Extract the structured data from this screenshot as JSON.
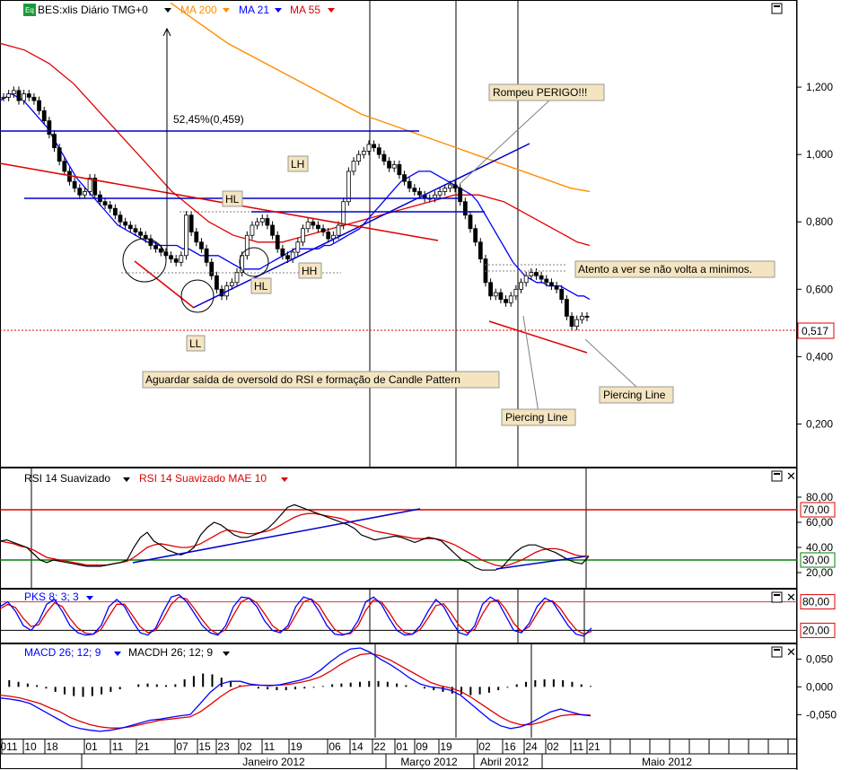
{
  "chart_data": [
    {
      "type": "line",
      "panel": "price",
      "title": "BES:xlis Diário TMG+0",
      "legend": [
        "BES:xlis Diário TMG+0",
        "MA 200",
        "MA 21",
        "MA 55"
      ],
      "legend_colors": {
        "MA 200": "#ff8c00",
        "MA 21": "#0000ff",
        "MA 55": "#e00000"
      },
      "y_ticks": [
        "1,200",
        "1,000",
        "0,800",
        "0,600",
        "0,400",
        "0,200"
      ],
      "ylim": [
        0.1,
        1.4
      ],
      "last_value": "0,517",
      "annotations": [
        "52,45%(0,459)",
        "LH",
        "HL",
        "HL",
        "HH",
        "LL",
        "Rompeu  PERIGO!!!",
        "Atento a ver se não volta a minimos.",
        "Aguardar saída de oversold do RSI e formação de Candle Pattern",
        "Piercing Line",
        "Piercing Line"
      ],
      "close": [
        1.17,
        1.18,
        1.19,
        1.16,
        1.18,
        1.17,
        1.16,
        1.13,
        1.1,
        1.06,
        1.02,
        0.98,
        0.95,
        0.92,
        0.9,
        0.88,
        0.89,
        0.93,
        0.88,
        0.86,
        0.85,
        0.84,
        0.82,
        0.8,
        0.79,
        0.78,
        0.77,
        0.76,
        0.75,
        0.73,
        0.72,
        0.71,
        0.7,
        0.69,
        0.68,
        0.7,
        0.82,
        0.77,
        0.74,
        0.72,
        0.68,
        0.64,
        0.6,
        0.58,
        0.61,
        0.62,
        0.65,
        0.7,
        0.76,
        0.79,
        0.8,
        0.81,
        0.79,
        0.76,
        0.72,
        0.7,
        0.69,
        0.71,
        0.74,
        0.78,
        0.8,
        0.79,
        0.78,
        0.77,
        0.75,
        0.76,
        0.79,
        0.86,
        0.95,
        0.98,
        1.0,
        1.01,
        1.03,
        1.02,
        1.0,
        0.98,
        0.96,
        0.97,
        0.94,
        0.92,
        0.9,
        0.89,
        0.88,
        0.87,
        0.87,
        0.88,
        0.89,
        0.9,
        0.91,
        0.9,
        0.86,
        0.82,
        0.78,
        0.74,
        0.69,
        0.62,
        0.58,
        0.59,
        0.57,
        0.56,
        0.58,
        0.6,
        0.62,
        0.64,
        0.65,
        0.64,
        0.63,
        0.62,
        0.61,
        0.6,
        0.57,
        0.52,
        0.49,
        0.51,
        0.52,
        0.517
      ],
      "ma21": [
        1.16,
        1.17,
        1.18,
        1.17,
        1.16,
        1.14,
        1.12,
        1.1,
        1.08,
        1.05,
        1.02,
        0.99,
        0.96,
        0.93,
        0.91,
        0.89,
        0.87,
        0.85,
        0.83,
        0.81,
        0.79,
        0.78,
        0.77,
        0.76,
        0.75,
        0.74,
        0.74,
        0.73,
        0.73,
        0.73,
        0.73,
        0.72,
        0.72,
        0.71,
        0.7,
        0.7,
        0.7,
        0.7,
        0.69,
        0.68,
        0.67,
        0.66,
        0.66,
        0.66,
        0.66,
        0.67,
        0.68,
        0.69,
        0.7,
        0.71,
        0.72,
        0.72,
        0.72,
        0.72,
        0.72,
        0.73,
        0.73,
        0.74,
        0.75,
        0.76,
        0.77,
        0.78,
        0.8,
        0.82,
        0.84,
        0.86,
        0.88,
        0.9,
        0.92,
        0.93,
        0.94,
        0.95,
        0.95,
        0.95,
        0.94,
        0.93,
        0.92,
        0.91,
        0.9,
        0.89,
        0.88,
        0.86,
        0.83,
        0.8,
        0.77,
        0.74,
        0.71,
        0.68,
        0.66,
        0.64,
        0.63,
        0.62,
        0.62,
        0.61,
        0.61,
        0.61,
        0.6,
        0.59,
        0.58,
        0.58,
        0.57
      ],
      "ma55": [
        1.33,
        1.32,
        1.31,
        1.29,
        1.27,
        1.24,
        1.21,
        1.17,
        1.13,
        1.09,
        1.05,
        1.01,
        0.97,
        0.93,
        0.89,
        0.86,
        0.83,
        0.8,
        0.78,
        0.76,
        0.75,
        0.74,
        0.74,
        0.74,
        0.75,
        0.76,
        0.77,
        0.78,
        0.79,
        0.8,
        0.81,
        0.82,
        0.83,
        0.84,
        0.85,
        0.86,
        0.87,
        0.88,
        0.88,
        0.88,
        0.87,
        0.86,
        0.84,
        0.82,
        0.8,
        0.78,
        0.76,
        0.74,
        0.73
      ],
      "ma200": [
        1.45,
        1.41,
        1.37,
        1.33,
        1.3,
        1.27,
        1.24,
        1.21,
        1.18,
        1.15,
        1.12,
        1.1,
        1.08,
        1.06,
        1.04,
        1.02,
        1.0,
        0.98,
        0.96,
        0.94,
        0.92,
        0.9,
        0.89
      ]
    },
    {
      "type": "line",
      "panel": "rsi",
      "legend": [
        "RSI 14 Suavizado",
        "RSI 14 Suavizado MAE 10"
      ],
      "y_ticks": [
        "80,00",
        "60,00",
        "40,00",
        "20,00"
      ],
      "levels": [
        "70,00",
        "30,00"
      ],
      "ylim": [
        10,
        90
      ],
      "rsi": [
        45,
        46,
        44,
        42,
        40,
        35,
        30,
        28,
        30,
        29,
        28,
        27,
        26,
        25,
        25,
        25,
        26,
        27,
        28,
        30,
        40,
        48,
        52,
        45,
        42,
        38,
        36,
        34,
        36,
        40,
        50,
        56,
        60,
        58,
        54,
        50,
        48,
        48,
        50,
        52,
        55,
        60,
        66,
        72,
        74,
        72,
        70,
        68,
        66,
        64,
        62,
        60,
        58,
        55,
        50,
        48,
        46,
        47,
        48,
        49,
        48,
        46,
        44,
        46,
        48,
        47,
        45,
        40,
        35,
        30,
        28,
        24,
        22,
        22,
        22,
        24,
        30,
        36,
        40,
        42,
        42,
        40,
        38,
        36,
        33,
        30,
        28,
        27,
        33
      ],
      "rsi_mae": [
        45,
        44,
        43,
        41,
        40,
        38,
        35,
        32,
        31,
        30,
        29,
        28,
        27,
        26,
        26,
        26,
        26,
        27,
        28,
        29,
        32,
        36,
        40,
        42,
        43,
        42,
        41,
        40,
        40,
        41,
        43,
        46,
        49,
        52,
        54,
        53,
        52,
        51,
        51,
        52,
        53,
        55,
        58,
        61,
        64,
        66,
        67,
        67,
        66,
        65,
        64,
        63,
        61,
        59,
        57,
        55,
        53,
        52,
        51,
        50,
        49,
        48,
        47,
        47,
        47,
        47,
        46,
        44,
        42,
        39,
        36,
        33,
        30,
        28,
        26,
        25,
        26,
        28,
        30,
        33,
        36,
        38,
        39,
        39,
        38,
        36,
        34,
        33,
        33
      ]
    },
    {
      "type": "line",
      "panel": "stochastic",
      "legend": [
        "PKS 8; 3; 3"
      ],
      "levels": [
        "80,00",
        "20,00"
      ],
      "ylim": [
        0,
        100
      ],
      "pks": [
        70,
        80,
        60,
        30,
        20,
        40,
        75,
        85,
        60,
        30,
        15,
        10,
        12,
        30,
        70,
        85,
        70,
        40,
        15,
        10,
        25,
        60,
        90,
        95,
        80,
        55,
        30,
        15,
        10,
        30,
        70,
        90,
        88,
        70,
        40,
        20,
        15,
        30,
        70,
        90,
        85,
        60,
        30,
        12,
        10,
        15,
        40,
        80,
        90,
        75,
        45,
        20,
        10,
        12,
        30,
        60,
        85,
        70,
        40,
        15,
        10,
        30,
        75,
        90,
        80,
        50,
        20,
        15,
        35,
        70,
        88,
        80,
        55,
        30,
        12,
        8,
        25
      ],
      "pks_signal": [
        65,
        75,
        68,
        45,
        28,
        32,
        58,
        78,
        70,
        45,
        25,
        14,
        12,
        22,
        50,
        75,
        75,
        52,
        28,
        15,
        20,
        45,
        75,
        90,
        86,
        65,
        42,
        22,
        12,
        22,
        52,
        80,
        88,
        78,
        55,
        30,
        18,
        24,
        52,
        80,
        86,
        72,
        45,
        22,
        12,
        13,
        30,
        62,
        84,
        80,
        58,
        32,
        15,
        12,
        22,
        46,
        72,
        76,
        55,
        30,
        15,
        22,
        55,
        80,
        84,
        64,
        35,
        18,
        28,
        55,
        80,
        82,
        66,
        42,
        22,
        12,
        18
      ]
    },
    {
      "type": "line",
      "panel": "macd",
      "legend": [
        "MACD 26; 12; 9",
        "MACDH 26; 12; 9"
      ],
      "y_ticks": [
        "0,050",
        "0,000",
        "-0,050"
      ],
      "ylim": [
        -0.085,
        0.07
      ],
      "macd": [
        -0.02,
        -0.022,
        -0.025,
        -0.03,
        -0.04,
        -0.05,
        -0.06,
        -0.07,
        -0.075,
        -0.078,
        -0.08,
        -0.078,
        -0.075,
        -0.07,
        -0.065,
        -0.06,
        -0.058,
        -0.055,
        -0.052,
        -0.05,
        -0.03,
        -0.01,
        0.005,
        0.01,
        0.01,
        0.005,
        0.003,
        0.002,
        0.004,
        0.008,
        0.012,
        0.018,
        0.03,
        0.045,
        0.058,
        0.068,
        0.07,
        0.062,
        0.05,
        0.04,
        0.028,
        0.015,
        0.005,
        0.0,
        -0.002,
        -0.006,
        -0.015,
        -0.03,
        -0.045,
        -0.06,
        -0.07,
        -0.075,
        -0.072,
        -0.065,
        -0.055,
        -0.045,
        -0.04,
        -0.045,
        -0.05,
        -0.052
      ],
      "macd_signal": [
        -0.015,
        -0.017,
        -0.02,
        -0.025,
        -0.03,
        -0.038,
        -0.045,
        -0.055,
        -0.062,
        -0.068,
        -0.072,
        -0.074,
        -0.074,
        -0.072,
        -0.068,
        -0.064,
        -0.06,
        -0.058,
        -0.056,
        -0.054,
        -0.045,
        -0.032,
        -0.018,
        -0.006,
        0.001,
        0.003,
        0.003,
        0.003,
        0.003,
        0.005,
        0.008,
        0.012,
        0.018,
        0.028,
        0.04,
        0.05,
        0.058,
        0.06,
        0.056,
        0.048,
        0.038,
        0.028,
        0.018,
        0.008,
        0.002,
        -0.002,
        -0.008,
        -0.018,
        -0.03,
        -0.042,
        -0.054,
        -0.063,
        -0.068,
        -0.068,
        -0.064,
        -0.058,
        -0.052,
        -0.05,
        -0.05,
        -0.051
      ],
      "macdh": [
        0.007,
        0.008,
        0.006,
        0.004,
        0.002,
        -0.002,
        -0.006,
        -0.009,
        -0.011,
        -0.012,
        -0.011,
        -0.009,
        -0.006,
        -0.003,
        0.0,
        0.003,
        0.004,
        0.003,
        0.002,
        0.003,
        0.009,
        0.013,
        0.016,
        0.015,
        0.011,
        0.006,
        0.002,
        0.0,
        -0.002,
        -0.003,
        -0.004,
        -0.004,
        -0.003,
        -0.002,
        -0.001,
        0.001,
        0.003,
        0.004,
        0.005,
        0.006,
        0.007,
        0.007,
        0.006,
        0.004,
        0.002,
        0.0,
        -0.002,
        -0.004,
        -0.006,
        -0.008,
        -0.009,
        -0.01,
        -0.009,
        -0.007,
        -0.004,
        -0.001,
        0.003,
        0.006,
        0.008,
        0.009,
        0.009,
        0.008,
        0.006,
        0.003,
        0.001
      ]
    }
  ],
  "x_axis": {
    "day_labels": [
      "011",
      "10",
      "18",
      "01",
      "11",
      "21",
      "07",
      "15",
      "23",
      "02",
      "11",
      "19",
      "06",
      "14",
      "22",
      "01",
      "09",
      "19",
      "02",
      "16",
      "24",
      "02",
      "11",
      "21"
    ],
    "month_labels": [
      "Janeiro 2012",
      "Março 2012",
      "Abril 2012",
      "Maio 2012"
    ]
  },
  "icons": {
    "series_badge": "eq-icon"
  }
}
